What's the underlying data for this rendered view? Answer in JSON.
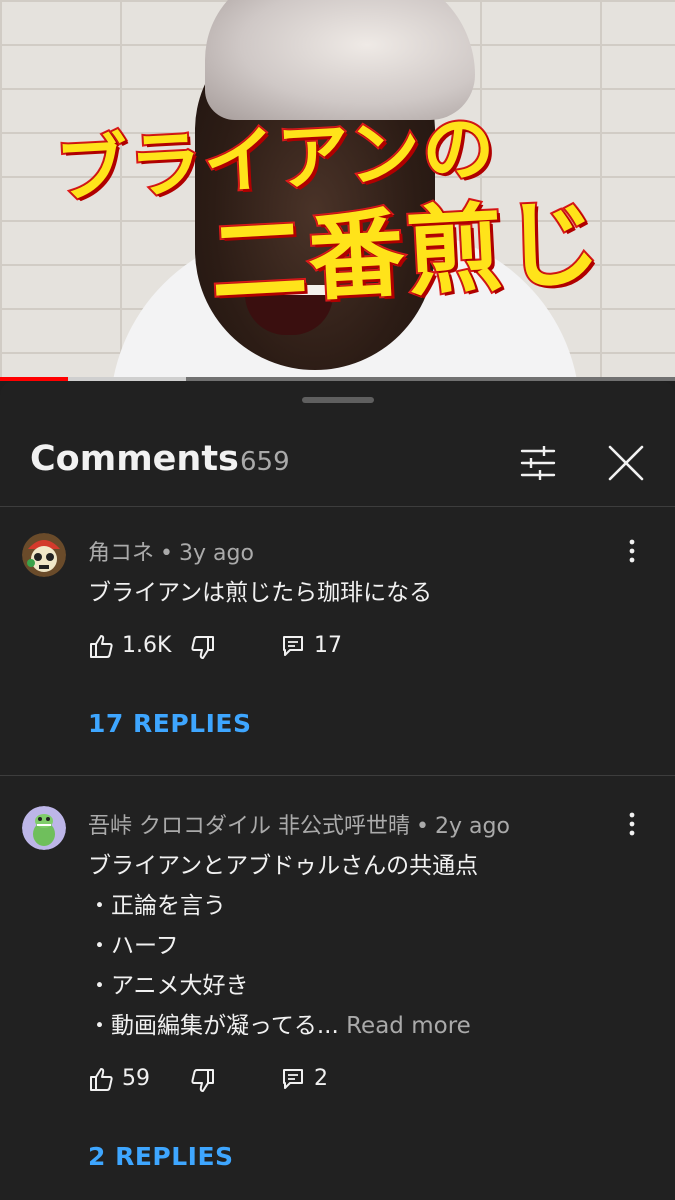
{
  "video": {
    "caption_line_1": "ブライアンの",
    "caption_line_2": "二番煎じ",
    "progress_played": 0.1,
    "progress_buffered": 0.275
  },
  "comments_panel": {
    "title": "Comments",
    "count": "659",
    "filter_icon": "sliders-icon",
    "close_icon": "close-icon"
  },
  "comments": [
    {
      "author": "角コネ",
      "separator": "•",
      "time": "3y ago",
      "lines": [
        "ブライアンは煎じたら珈琲になる"
      ],
      "read_more": "",
      "likes": "1.6K",
      "reply_count": "17",
      "replies_label": "17 REPLIES"
    },
    {
      "author": "吾峠 クロコダイル 非公式呼世晴",
      "separator": "•",
      "time": "2y ago",
      "lines": [
        "ブライアンとアブドゥルさんの共通点",
        "・正論を言う",
        "・ハーフ",
        "・アニメ大好き",
        "・動画編集が凝ってる..."
      ],
      "read_more": "Read more",
      "likes": "59",
      "reply_count": "2",
      "replies_label": "2 REPLIES"
    }
  ],
  "colors": {
    "sheet_bg": "#212121",
    "link_blue": "#3ea6ff",
    "progress_red": "#ff0000",
    "caption_yellow": "#ffe31a",
    "caption_red": "#e01b1b"
  }
}
